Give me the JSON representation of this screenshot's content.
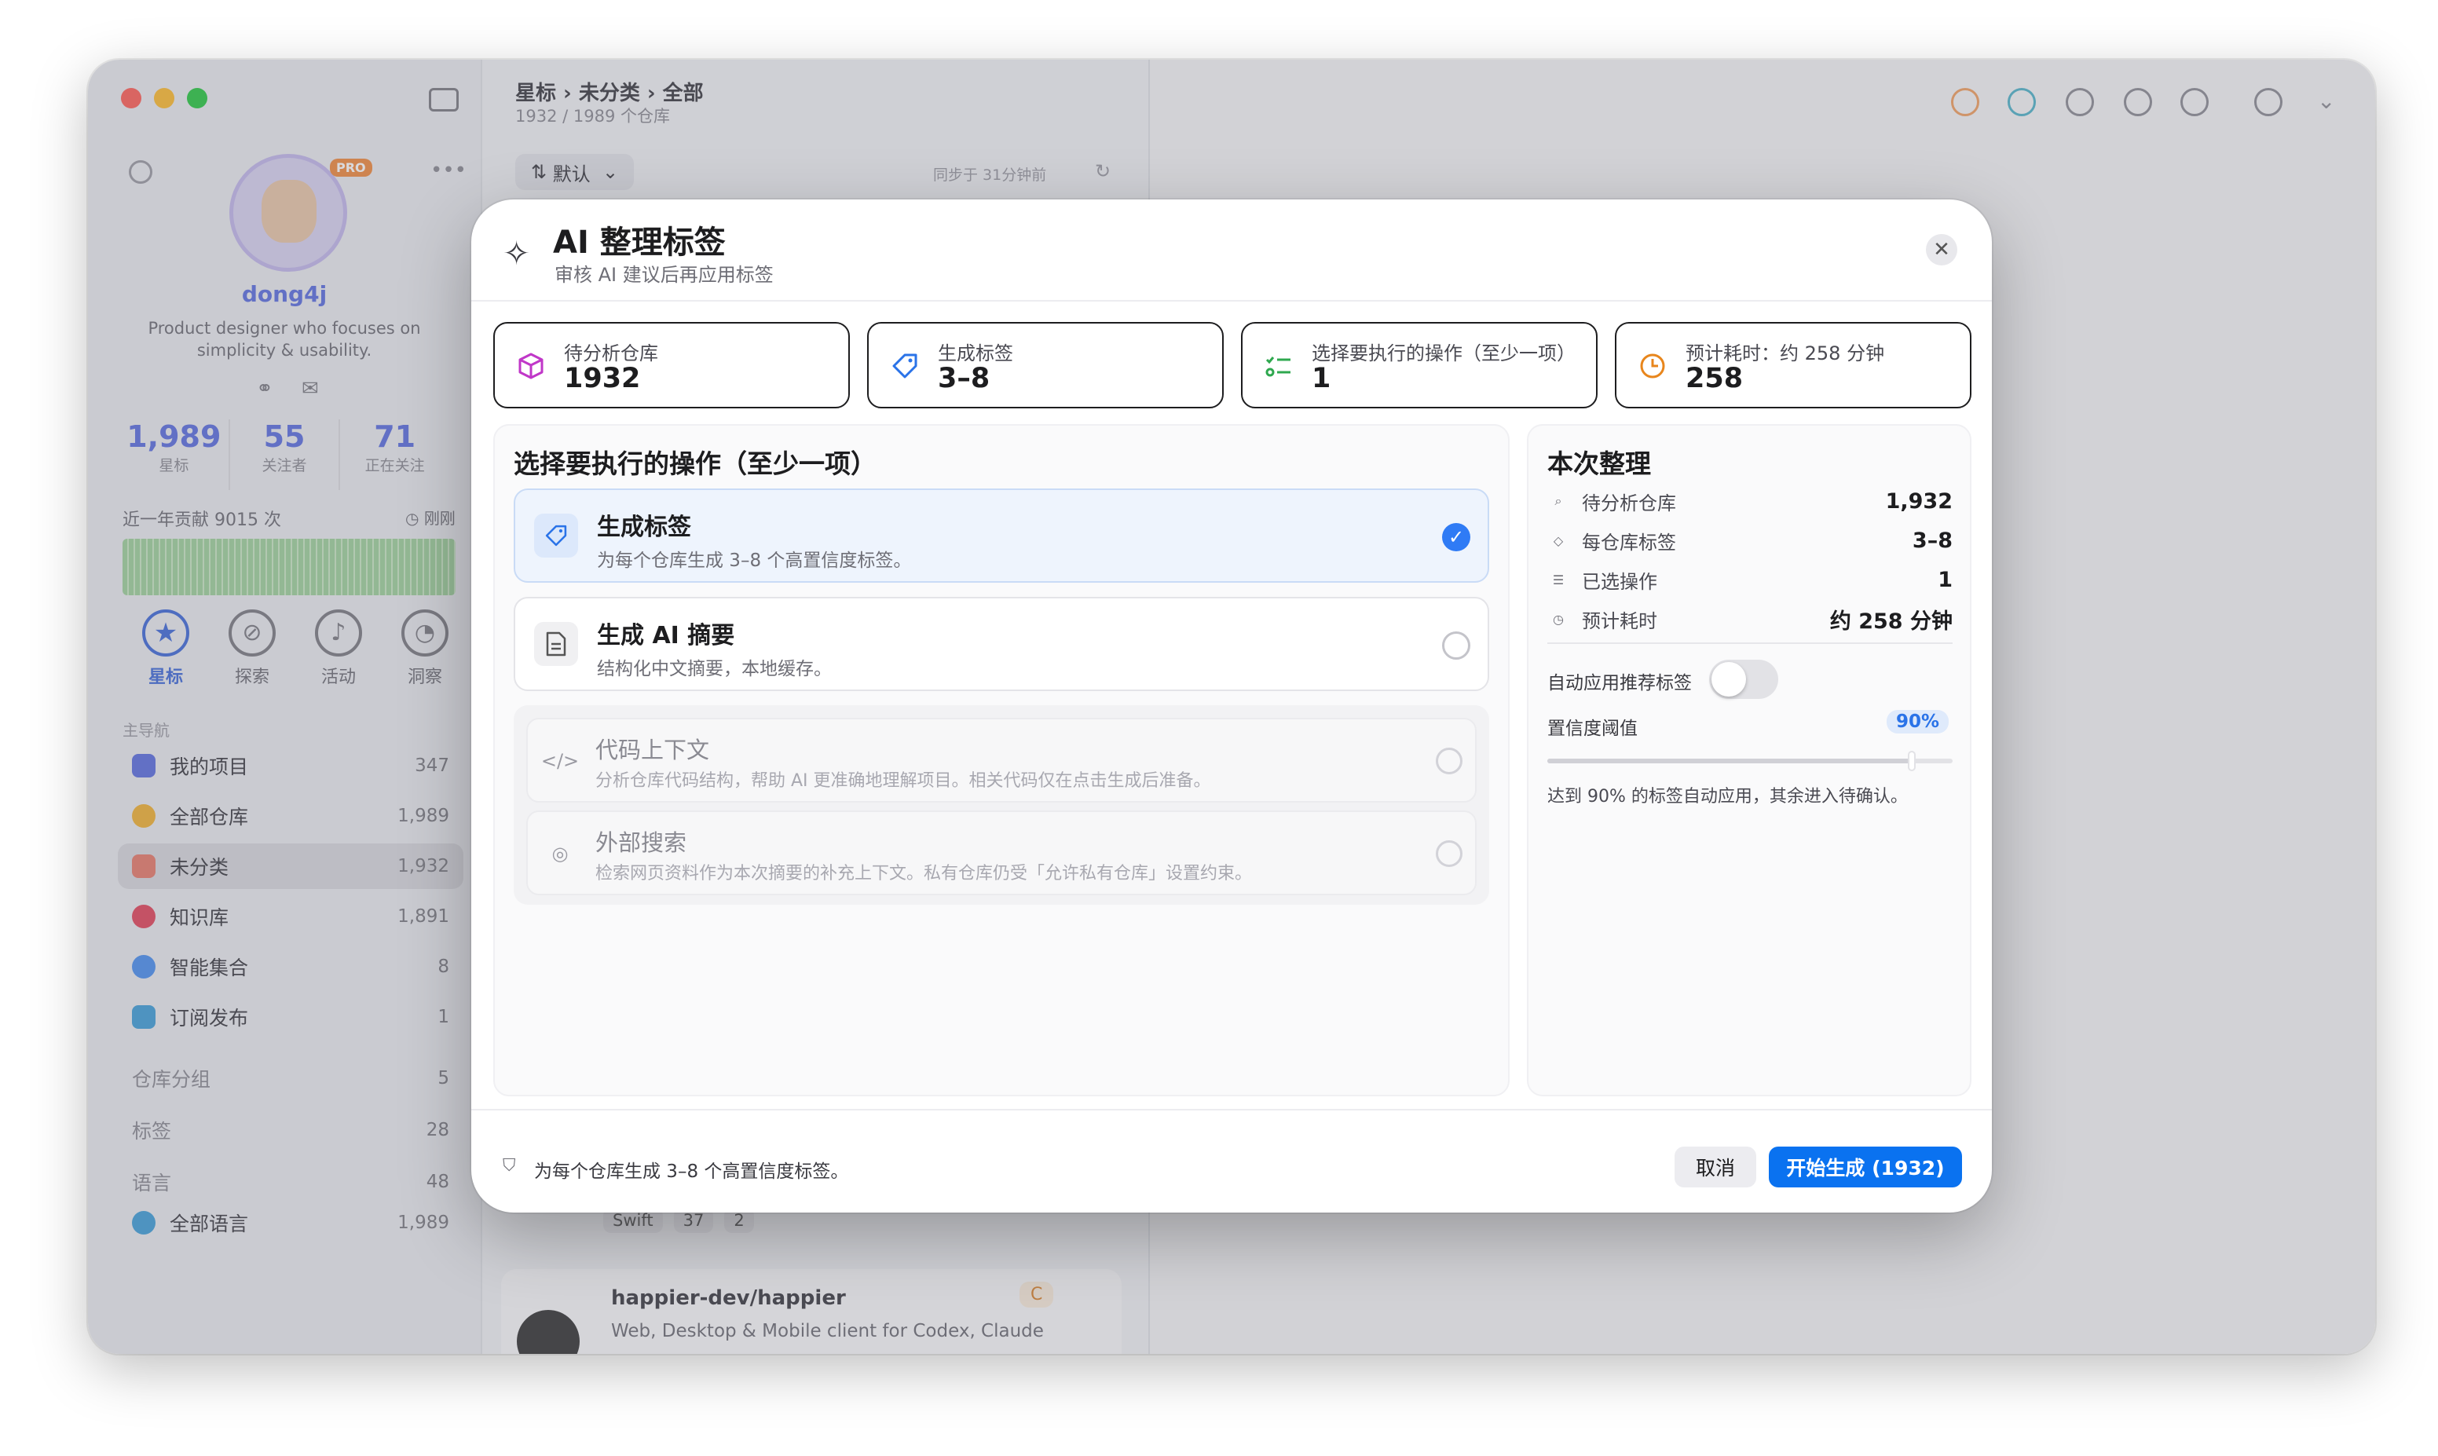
{
  "sidebar": {
    "username": "dong4j",
    "pro_badge": "PRO",
    "bio": "Product designer who focuses on simplicity & usability.",
    "stats": [
      {
        "value": "1,989",
        "label": "星标"
      },
      {
        "value": "55",
        "label": "关注者"
      },
      {
        "value": "71",
        "label": "正在关注"
      }
    ],
    "contrib_title": "近一年贡献 9015 次",
    "contrib_time": "刚刚",
    "tabs": [
      {
        "label": "星标",
        "icon": "star-icon"
      },
      {
        "label": "探索",
        "icon": "compass-icon"
      },
      {
        "label": "活动",
        "icon": "bell-icon"
      },
      {
        "label": "洞察",
        "icon": "gauge-icon"
      }
    ],
    "section_label": "主导航",
    "nav": [
      {
        "label": "我的项目",
        "count": "347",
        "color": "#5b6ee0"
      },
      {
        "label": "全部仓库",
        "count": "1,989",
        "color": "#f2b233"
      },
      {
        "label": "未分类",
        "count": "1,932",
        "color": "#e87a6a"
      },
      {
        "label": "知识库",
        "count": "1,891",
        "color": "#e2455a"
      },
      {
        "label": "智能集合",
        "count": "8",
        "color": "#4a8ff0"
      },
      {
        "label": "订阅发布",
        "count": "1",
        "color": "#3f9fd8"
      }
    ],
    "groups": [
      {
        "label": "仓库分组",
        "count": "5"
      },
      {
        "label": "标签",
        "count": "28"
      },
      {
        "label": "语言",
        "count": "48"
      }
    ],
    "all_languages": {
      "label": "全部语言",
      "count": "1,989"
    }
  },
  "middle": {
    "breadcrumb": "星标 › 未分类 › 全部",
    "subtitle": "1932 / 1989 个仓库",
    "sort_label": "默认",
    "sync_text": "同步于 31分钟前",
    "repo_tags": [
      "Swift",
      "37",
      "2"
    ],
    "repo_name": "happier-dev/happier",
    "repo_desc": "Web, Desktop & Mobile client for Codex, Claude",
    "repo_badge": "C"
  },
  "modal": {
    "title": "AI 整理标签",
    "subtitle": "审核 AI 建议后再应用标签",
    "stats": [
      {
        "label": "待分析仓库",
        "value": "1932",
        "icon": "cube-icon",
        "bg": "#fbe8fb",
        "border": "#ecc4ee",
        "color": "#c037c8"
      },
      {
        "label": "生成标签",
        "value": "3–8",
        "icon": "tag-icon",
        "bg": "#e6f0fd",
        "border": "#bcd4f4",
        "color": "#2a73e8"
      },
      {
        "label": "选择要执行的操作（至少一项）",
        "value": "1",
        "icon": "list-check-icon",
        "bg": "#e8f7ec",
        "border": "#c2e6cc",
        "color": "#2fa84f"
      },
      {
        "label": "预计耗时：约 258 分钟",
        "value": "258",
        "icon": "clock-icon",
        "bg": "#fdf0e4",
        "border": "#f3d2b2",
        "color": "#e8861c"
      }
    ],
    "ops_title": "选择要执行的操作（至少一项）",
    "options": [
      {
        "title": "生成标签",
        "desc": "为每个仓库生成 3–8 个高置信度标签。",
        "selected": true
      },
      {
        "title": "生成 AI 摘要",
        "desc": "结构化中文摘要，本地缓存。",
        "selected": false
      }
    ],
    "disabled_options": [
      {
        "title": "代码上下文",
        "desc": "分析仓库代码结构，帮助 AI 更准确地理解项目。相关代码仅在点击生成后准备。",
        "glyph": "</>"
      },
      {
        "title": "外部搜索",
        "desc": "检索网页资料作为本次摘要的补充上下文。私有仓库仍受「允许私有仓库」设置约束。",
        "glyph": "◎"
      }
    ],
    "summary_title": "本次整理",
    "summary": [
      {
        "key": "待分析仓库",
        "value": "1,932",
        "icon": "search-icon",
        "glyph": "⌕"
      },
      {
        "key": "每仓库标签",
        "value": "3–8",
        "icon": "tag-icon",
        "glyph": "◇"
      },
      {
        "key": "已选操作",
        "value": "1",
        "icon": "list-icon",
        "glyph": "☰"
      },
      {
        "key": "预计耗时",
        "value": "约 258 分钟",
        "icon": "clock-icon",
        "glyph": "◷"
      }
    ],
    "auto_apply_label": "自动应用推荐标签",
    "auto_apply_on": false,
    "threshold_label": "置信度阈值",
    "threshold_value": "90%",
    "threshold_fraction": 0.9,
    "threshold_note": "达到 90% 的标签自动应用，其余进入待确认。",
    "footer_note": "为每个仓库生成 3–8 个高置信度标签。",
    "cancel_label": "取消",
    "start_label": "开始生成 (1932)"
  }
}
